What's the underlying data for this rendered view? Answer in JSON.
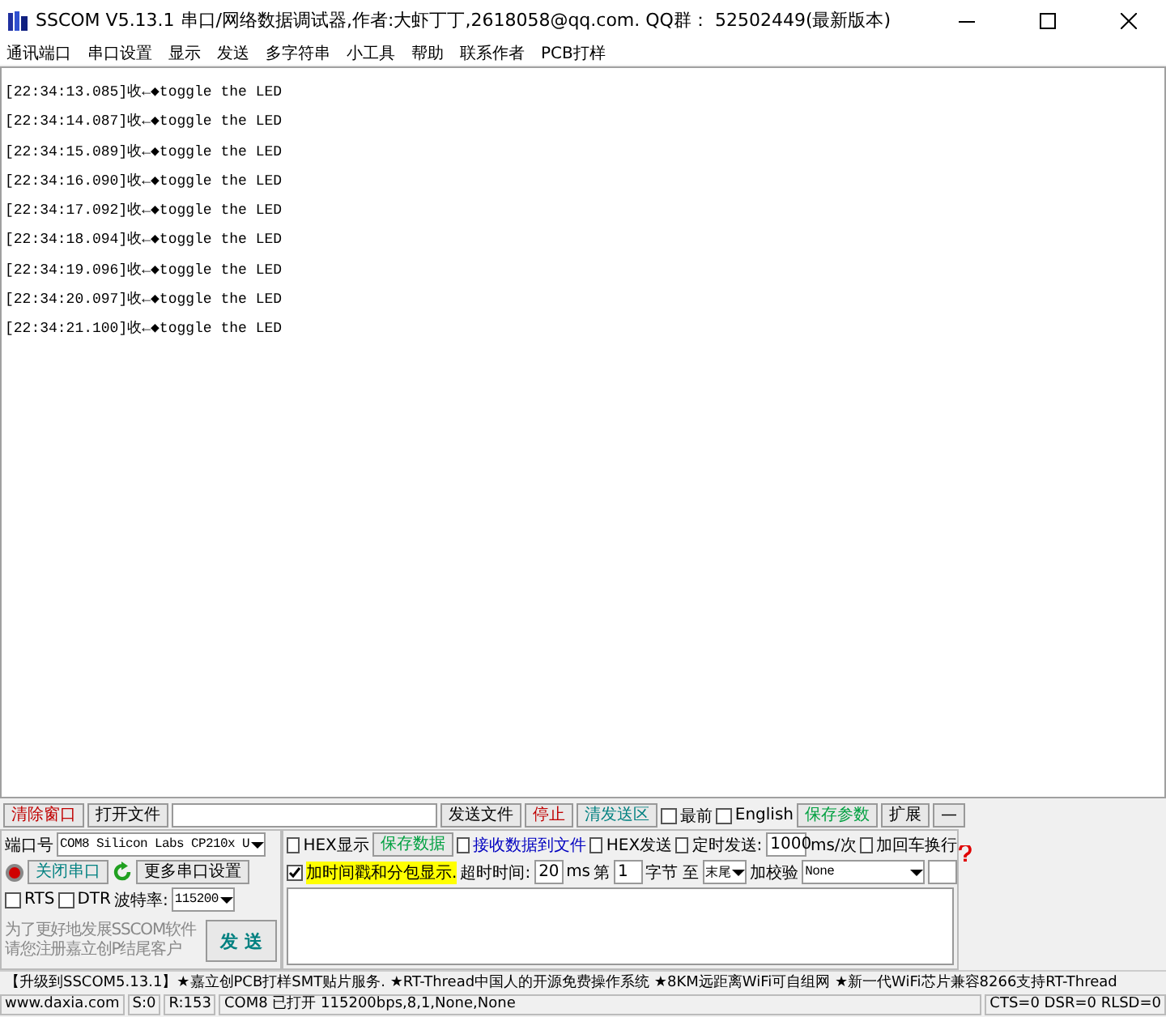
{
  "window": {
    "title": "SSCOM V5.13.1 串口/网络数据调试器,作者:大虾丁丁,2618058@qq.com. QQ群： 52502449(最新版本)"
  },
  "menu": [
    "通讯端口",
    "串口设置",
    "显示",
    "发送",
    "多字符串",
    "小工具",
    "帮助",
    "联系作者",
    "PCB打样"
  ],
  "log": [
    "[22:34:13.085]收←◆toggle the LED",
    "[22:34:14.087]收←◆toggle the LED",
    "[22:34:15.089]收←◆toggle the LED",
    "[22:34:16.090]收←◆toggle the LED",
    "[22:34:17.092]收←◆toggle the LED",
    "[22:34:18.094]收←◆toggle the LED",
    "[22:34:19.096]收←◆toggle the LED",
    "[22:34:20.097]收←◆toggle the LED",
    "[22:34:21.100]收←◆toggle the LED"
  ],
  "top_row": [
    {
      "kind": "button",
      "label": "清除窗口",
      "color": "#c00000"
    },
    {
      "kind": "button",
      "label": "打开文件",
      "color": "#000000"
    },
    {
      "kind": "wide-field"
    },
    {
      "kind": "button",
      "label": "发送文件",
      "color": "#000000"
    },
    {
      "kind": "button",
      "label": "停止",
      "color": "#c00000"
    },
    {
      "kind": "button",
      "label": "清发送区",
      "color": "#008080"
    },
    {
      "kind": "checkbox",
      "label": "最前",
      "checked": false
    },
    {
      "kind": "checkbox",
      "label": "English",
      "checked": false
    },
    {
      "kind": "button",
      "label": "保存参数",
      "color": "#00a040"
    },
    {
      "kind": "button",
      "label": "扩展",
      "color": "#000000"
    },
    {
      "kind": "button",
      "label": "—",
      "color": "#000000"
    }
  ],
  "left_panel": [
    [
      {
        "kind": "label",
        "label": "端口号"
      },
      {
        "kind": "combo",
        "value": "COM8 Silicon Labs CP210x U"
      }
    ],
    [
      {
        "kind": "led"
      },
      {
        "kind": "button",
        "label": "关闭串口",
        "color": "#008080"
      },
      {
        "kind": "refresh"
      },
      {
        "kind": "button",
        "label": "更多串口设置",
        "color": "#000000"
      }
    ],
    [
      {
        "kind": "checkbox",
        "label": "RTS",
        "checked": false
      },
      {
        "kind": "checkbox",
        "label": "DTR",
        "checked": false
      },
      {
        "kind": "label",
        "label": "波特率:"
      },
      {
        "kind": "combo",
        "value": "115200"
      }
    ]
  ],
  "notice": [
    "为了更好地发展SSCOM软件",
    "请您注册嘉立创P结尾客户"
  ],
  "send_button": {
    "label": "发  送",
    "color": "#008080"
  },
  "right_panel": [
    [
      {
        "kind": "checkbox",
        "label": "HEX显示",
        "checked": false
      },
      {
        "kind": "button",
        "label": "保存数据",
        "color": "#00a040"
      },
      {
        "kind": "checkbox",
        "label": "接收数据到文件",
        "checked": false,
        "color": "#0000c0"
      },
      {
        "kind": "checkbox",
        "label": "HEX发送",
        "checked": false
      },
      {
        "kind": "checkbox",
        "label": "定时发送:",
        "checked": false
      },
      {
        "kind": "field",
        "value": "1000"
      },
      {
        "kind": "label",
        "label": "ms/次"
      },
      {
        "kind": "checkbox",
        "label": "加回车换行",
        "checked": false
      }
    ],
    [
      {
        "kind": "checkbox",
        "label": "加时间戳和分包显示.",
        "checked": true,
        "highlighted": true
      },
      {
        "kind": "label",
        "label": "超时时间:"
      },
      {
        "kind": "field",
        "value": "20"
      },
      {
        "kind": "label",
        "label": "ms"
      },
      {
        "kind": "label",
        "label": "第"
      },
      {
        "kind": "field",
        "value": "1"
      },
      {
        "kind": "label",
        "label": "字节 至"
      },
      {
        "kind": "combo",
        "value": "末尾"
      },
      {
        "kind": "label",
        "label": "加校验"
      },
      {
        "kind": "combo",
        "value": "None",
        "wide": true
      },
      {
        "kind": "field"
      }
    ]
  ],
  "ticker": "【升级到SSCOM5.13.1】★嘉立创PCB打样SMT贴片服务. ★RT-Thread中国人的开源免费操作系统 ★8KM远距离WiFi可自组网 ★新一代WiFi芯片兼容8266支持RT-Thread",
  "status_bar": [
    "www.daxia.com",
    "S:0",
    "R:153",
    "COM8 已打开  115200bps,8,1,None,None",
    "CTS=0 DSR=0 RLSD=0"
  ]
}
